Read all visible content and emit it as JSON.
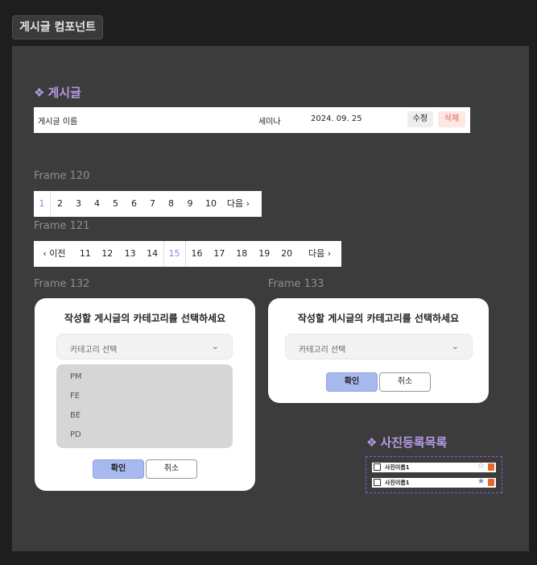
{
  "page_tag": "게시글 컴포넌트",
  "post_section": {
    "title": "게시글",
    "row": {
      "name": "게시글 이름",
      "category": "세미나",
      "date": "2024. 09. 25",
      "edit": "수정",
      "delete": "삭제"
    }
  },
  "frame120": {
    "label": "Frame 120",
    "pages": [
      "1",
      "2",
      "3",
      "4",
      "5",
      "6",
      "7",
      "8",
      "9",
      "10"
    ],
    "next": "다음 ›"
  },
  "frame121": {
    "label": "Frame 121",
    "prev": "‹  이전",
    "pages": [
      "11",
      "12",
      "13",
      "14",
      "15",
      "16",
      "17",
      "18",
      "19",
      "20"
    ],
    "next": "다음  ›"
  },
  "frame132": {
    "label": "Frame 132",
    "title": "작성할 게시글의 카테고리를 선택하세요",
    "select_placeholder": "카테고리 선택",
    "options": [
      "PM",
      "FE",
      "BE",
      "PD"
    ],
    "ok": "확인",
    "cancel": "취소"
  },
  "frame133": {
    "label": "Frame 133",
    "title": "작성할 게시글의 카테고리를 선택하세요",
    "select_placeholder": "카테고리 선택",
    "ok": "확인",
    "cancel": "취소"
  },
  "photo_section": {
    "title": "사진등록목록",
    "items": [
      {
        "name": "사진이름1",
        "starred": false
      },
      {
        "name": "사진이름1",
        "starred": true
      }
    ]
  },
  "colors": {
    "accent_purple": "#b79be6",
    "pager_active": "#7c8fd8",
    "confirm": "#a8b9f0",
    "delete_text": "#e0644d"
  }
}
